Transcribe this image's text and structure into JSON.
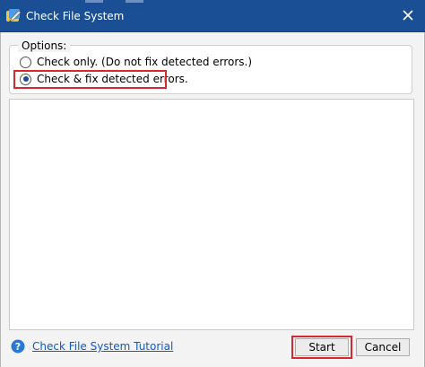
{
  "window": {
    "title": "Check File System",
    "titlebar_color": "#1b4f95",
    "app_icon": "app-icon",
    "close_icon": "close-icon"
  },
  "options": {
    "legend": "Options:",
    "items": [
      {
        "label": "Check only. (Do not fix detected errors.)",
        "checked": false
      },
      {
        "label": "Check & fix detected errors.",
        "checked": true
      }
    ]
  },
  "footer": {
    "help_icon": "help-icon",
    "tutorial_link": "Check File System Tutorial",
    "start_label": "Start",
    "cancel_label": "Cancel"
  },
  "colors": {
    "highlight": "#d8272e",
    "link": "#0f59c9"
  }
}
